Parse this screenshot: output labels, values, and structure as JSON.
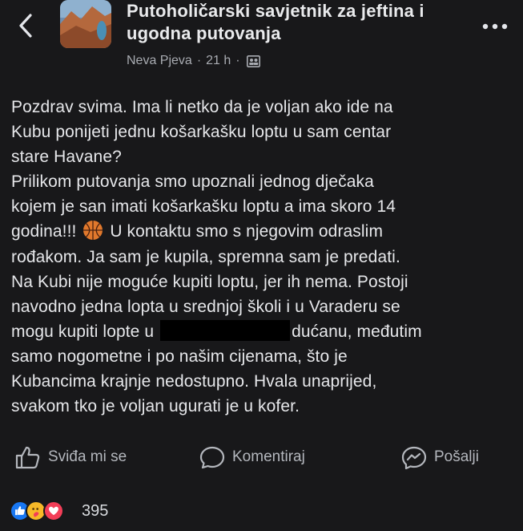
{
  "header": {
    "group_title": "Putoholičarski savjetnik za jeftina i ugodna putovanja",
    "author": "Neva Pjeva",
    "time": "21 h",
    "separator": "·"
  },
  "post": {
    "line_1": "Pozdrav svima. Ima li netko da je voljan ako ide na",
    "line_2": "Kubu ponijeti jednu košarkašku loptu u sam centar",
    "line_3": "stare Havane?",
    "line_4": "Prilikom putovanja smo upoznali jednog dječaka",
    "line_5": "kojem je san imati košarkašku loptu a ima skoro 14",
    "line_6a": "godina!!!",
    "line_6b": "U kontaktu smo s njegovim odraslim",
    "line_7": "rođakom. Ja sam je kupila, spremna sam je predati.",
    "line_8": "Na Kubi nije moguće kupiti loptu, jer ih nema. Postoji",
    "line_9": "navodno jedna lopta u srednjoj školi i u Varaderu se",
    "line_10a": "mogu kupiti lopte u",
    "line_10b": "dućanu, međutim",
    "line_11": "samo nogometne i po našim cijenama, što je",
    "line_12": "Kubancima krajnje nedostupno. Hvala unaprijed,",
    "line_13": "svakom tko je voljan ugurati je u kofer."
  },
  "actions": {
    "like_label": "Sviđa mi se",
    "comment_label": "Komentiraj",
    "send_label": "Pošalji"
  },
  "reactions": {
    "count": "395",
    "types": [
      "like-icon",
      "care-icon",
      "love-icon"
    ]
  },
  "icons": {
    "back": "chevron-left-icon",
    "more": "more-dots-icon",
    "members": "members-icon",
    "basketball": "basketball-emoji"
  },
  "colors": {
    "background": "#18181a",
    "text": "#e6e7ea",
    "meta": "#a9acb2",
    "like_blue": "#1877f2",
    "love_red": "#f33e58",
    "care_yellow": "#f7b928"
  }
}
